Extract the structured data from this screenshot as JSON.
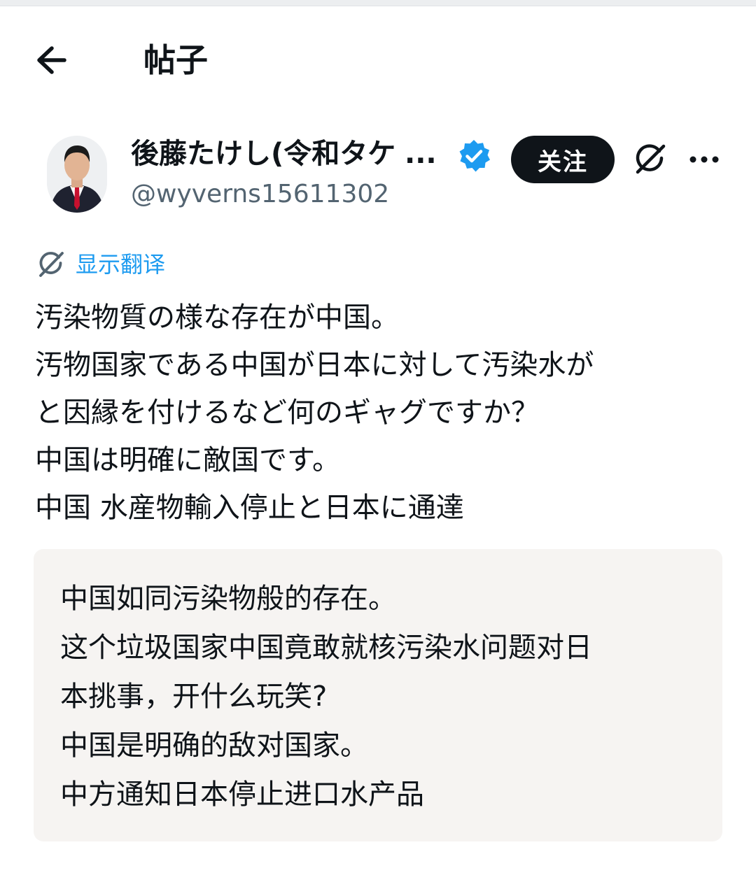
{
  "header": {
    "back_icon": "back-arrow-icon",
    "title": "帖子"
  },
  "author": {
    "display_name": "後藤たけし(令和タケ",
    "ellipsis": "...",
    "verified_icon": "verified-badge-icon",
    "handle": "@wyverns15611302",
    "follow_label": "关注",
    "grok_icon": "grok-icon",
    "more_icon": "more-icon"
  },
  "translate": {
    "icon": "grok-icon",
    "label": "显示翻译"
  },
  "post": {
    "lines": [
      "汚染物質の様な存在が中国。",
      "汚物国家である中国が日本に対して汚染水が",
      "と因縁を付けるなど何のギャグですか？",
      "中国は明確に敵国です。",
      "中国 水産物輸入停止と日本に通達"
    ]
  },
  "translation": {
    "lines": [
      "中国如同污染物般的存在。",
      "这个垃圾国家中国竟敢就核污染水问题对日",
      "本挑事，开什么玩笑?",
      "中国是明确的敌对国家。",
      "中方通知日本停止进口水产品"
    ]
  },
  "colors": {
    "accent": "#1d9bf0",
    "text_primary": "#0f1419",
    "text_secondary": "#536471",
    "follow_bg": "#0f1419",
    "translation_bg": "#f6f4f2"
  }
}
